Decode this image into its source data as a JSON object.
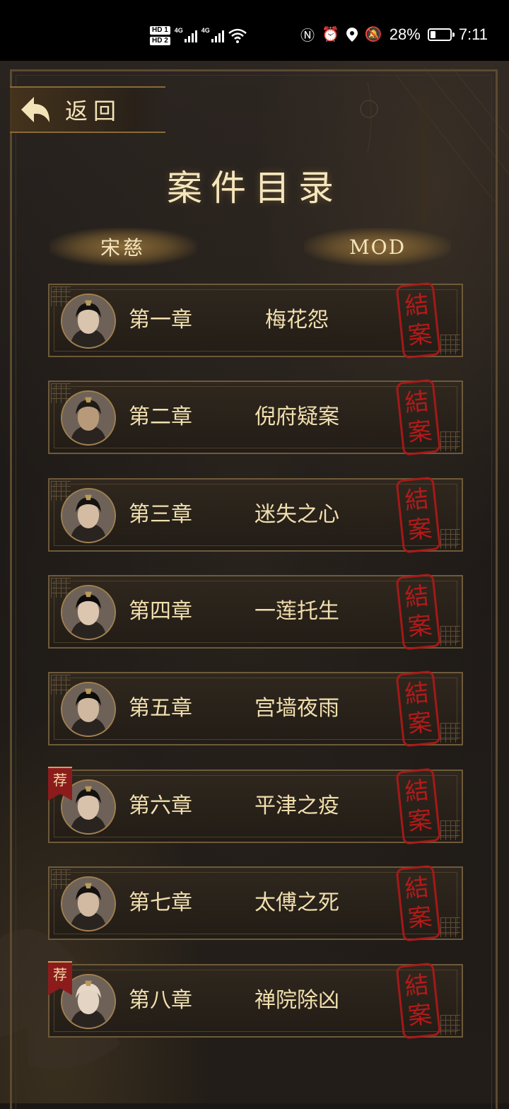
{
  "status_bar": {
    "hd1": "HD 1",
    "hd2": "HD 2",
    "net1": "4G",
    "net2": "4G",
    "battery": "28%",
    "battery_level": 0.28,
    "time": "7:11"
  },
  "header": {
    "back_label": "返回",
    "title": "案件目录"
  },
  "tabs": [
    {
      "label": "宋慈"
    },
    {
      "label": "MOD"
    }
  ],
  "seal_char_top": "結",
  "seal_char_bottom": "案",
  "badge_label": "荐",
  "chapters": [
    {
      "number": "第一章",
      "name": "梅花怨",
      "closed": true,
      "recommended": false
    },
    {
      "number": "第二章",
      "name": "倪府疑案",
      "closed": true,
      "recommended": false
    },
    {
      "number": "第三章",
      "name": "迷失之心",
      "closed": true,
      "recommended": false
    },
    {
      "number": "第四章",
      "name": "一莲托生",
      "closed": true,
      "recommended": false
    },
    {
      "number": "第五章",
      "name": "宫墙夜雨",
      "closed": true,
      "recommended": false
    },
    {
      "number": "第六章",
      "name": "平津之疫",
      "closed": true,
      "recommended": true
    },
    {
      "number": "第七章",
      "name": "太傅之死",
      "closed": true,
      "recommended": false
    },
    {
      "number": "第八章",
      "name": "禅院除凶",
      "closed": true,
      "recommended": true
    }
  ],
  "colors": {
    "gold_text": "#f1dfae",
    "seal_red": "#c01a1a",
    "frame": "#6e5a3a",
    "badge_red": "#8c1c1c"
  }
}
